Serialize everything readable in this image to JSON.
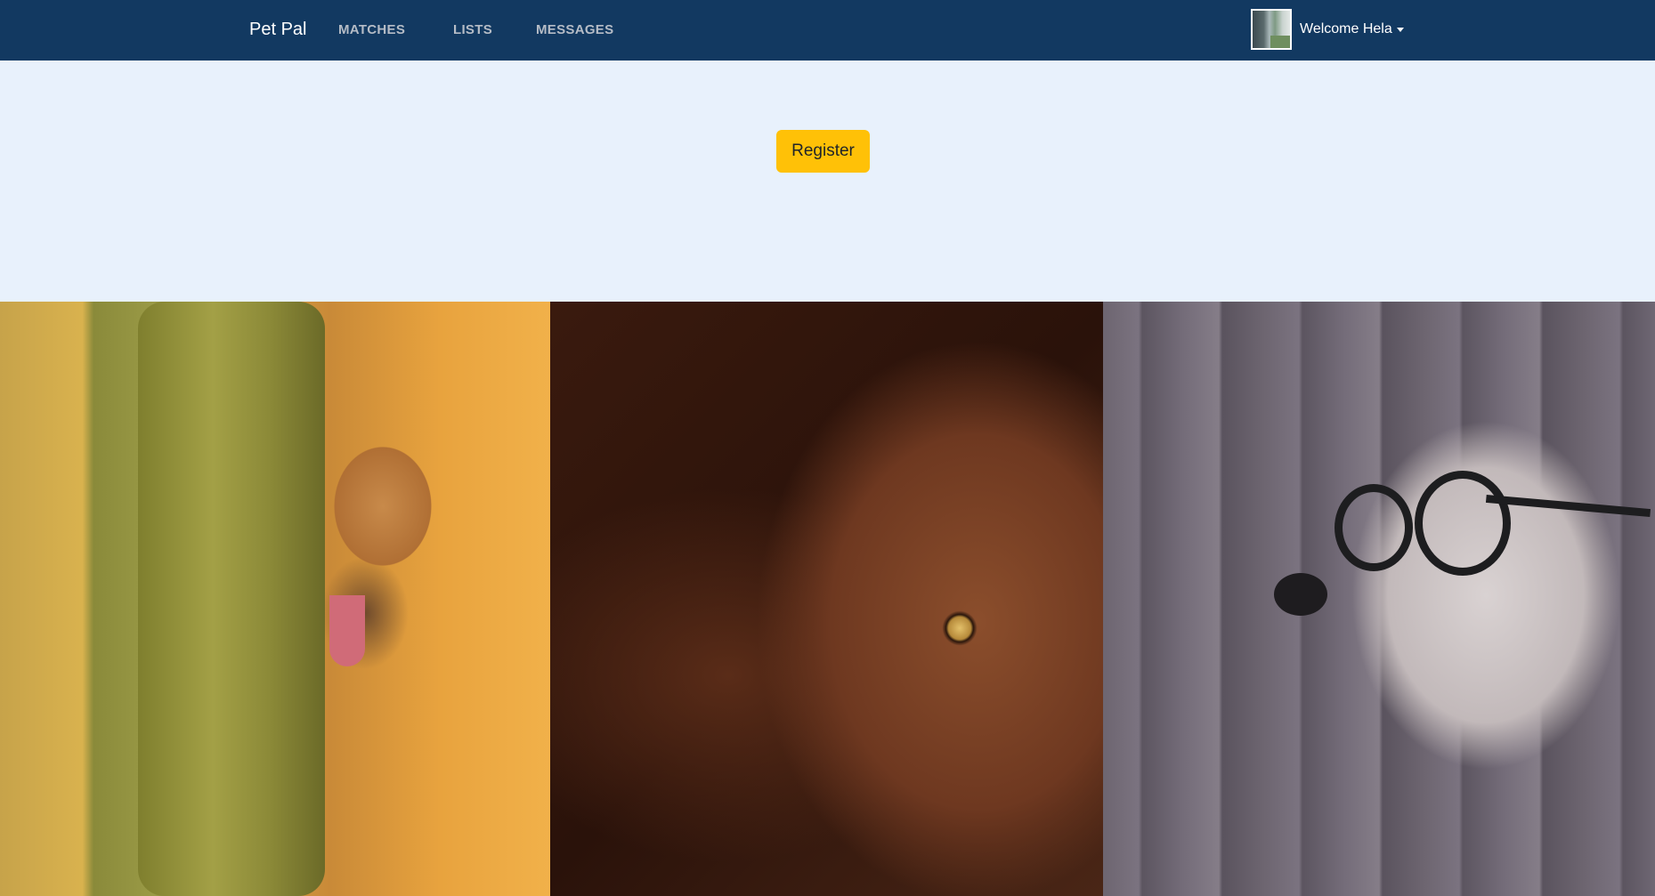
{
  "navbar": {
    "brand": "Pet Pal",
    "links": [
      "MATCHES",
      "LISTS",
      "MESSAGES"
    ],
    "user_greeting": "Welcome Hela",
    "background": "#123961"
  },
  "hero": {
    "register_label": "Register",
    "button_color": "#ffc107",
    "background": "#e8f1fc"
  },
  "gallery": {
    "photos": [
      "german-shepherd-tree-photo",
      "pitbull-closeup-photo",
      "terrier-glasses-photo"
    ]
  }
}
